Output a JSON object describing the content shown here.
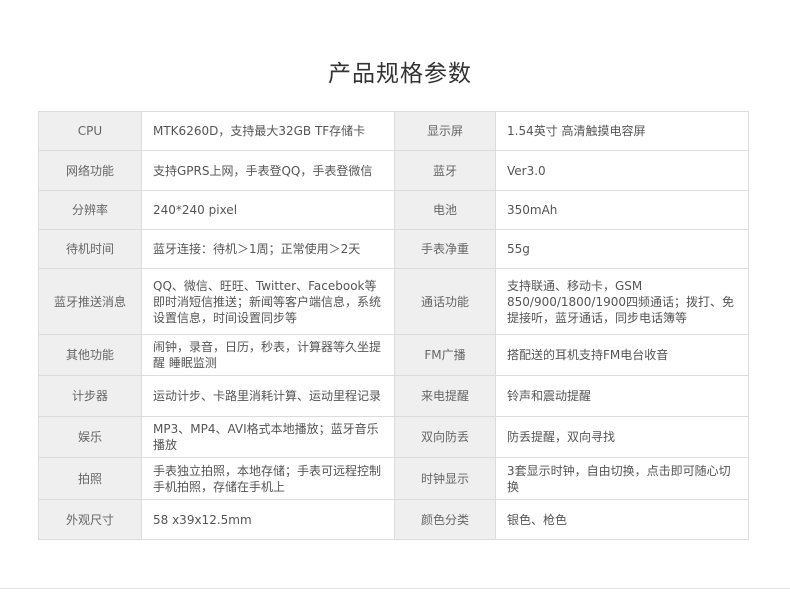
{
  "title": "产品规格参数",
  "rows": [
    {
      "label1": "CPU",
      "value1": "MTK6260D，支持最大32GB TF存储卡",
      "label2": "显示屏",
      "value2": "1.54英寸 高清触摸电容屏"
    },
    {
      "label1": "网络功能",
      "value1": "支持GPRS上网，手表登QQ，手表登微信",
      "label2": "蓝牙",
      "value2": "Ver3.0"
    },
    {
      "label1": "分辨率",
      "value1": "240*240 pixel",
      "label2": "电池",
      "value2": "350mAh"
    },
    {
      "label1": "待机时间",
      "value1": "蓝牙连接：待机＞1周；正常使用＞2天",
      "label2": "手表净重",
      "value2": "55g"
    },
    {
      "label1": "蓝牙推送消息",
      "value1": "QQ、微信、旺旺、Twitter、Facebook等即时消短信推送；新闻等客户端信息，系统设置信息，时间设置同步等",
      "label2": "通话功能",
      "value2": "支持联通、移动卡，GSM　850/900/1800/1900四频通话；拨打、免提接听，蓝牙通话，同步电话簿等"
    },
    {
      "label1": "其他功能",
      "value1": "闹钟，录音，日历，秒表，计算器等久坐提醒 睡眠监测",
      "label2": "FM广播",
      "value2": "搭配送的耳机支持FM电台收音"
    },
    {
      "label1": "计步器",
      "value1": "运动计步、卡路里消耗计算、运动里程记录",
      "label2": "来电提醒",
      "value2": "铃声和震动提醒"
    },
    {
      "label1": "娱乐",
      "value1": "MP3、MP4、AVI格式本地播放；蓝牙音乐播放",
      "label2": "双向防丢",
      "value2": "防丢提醒，双向寻找"
    },
    {
      "label1": "拍照",
      "value1": "手表独立拍照，本地存储；手表可远程控制手机拍照，存储在手机上",
      "label2": "时钟显示",
      "value2": "3套显示时钟，自由切换，点击即可随心切换"
    },
    {
      "label1": "外观尺寸",
      "value1": "58 x39x12.5mm",
      "label2": "颜色分类",
      "value2": "银色、枪色"
    }
  ]
}
